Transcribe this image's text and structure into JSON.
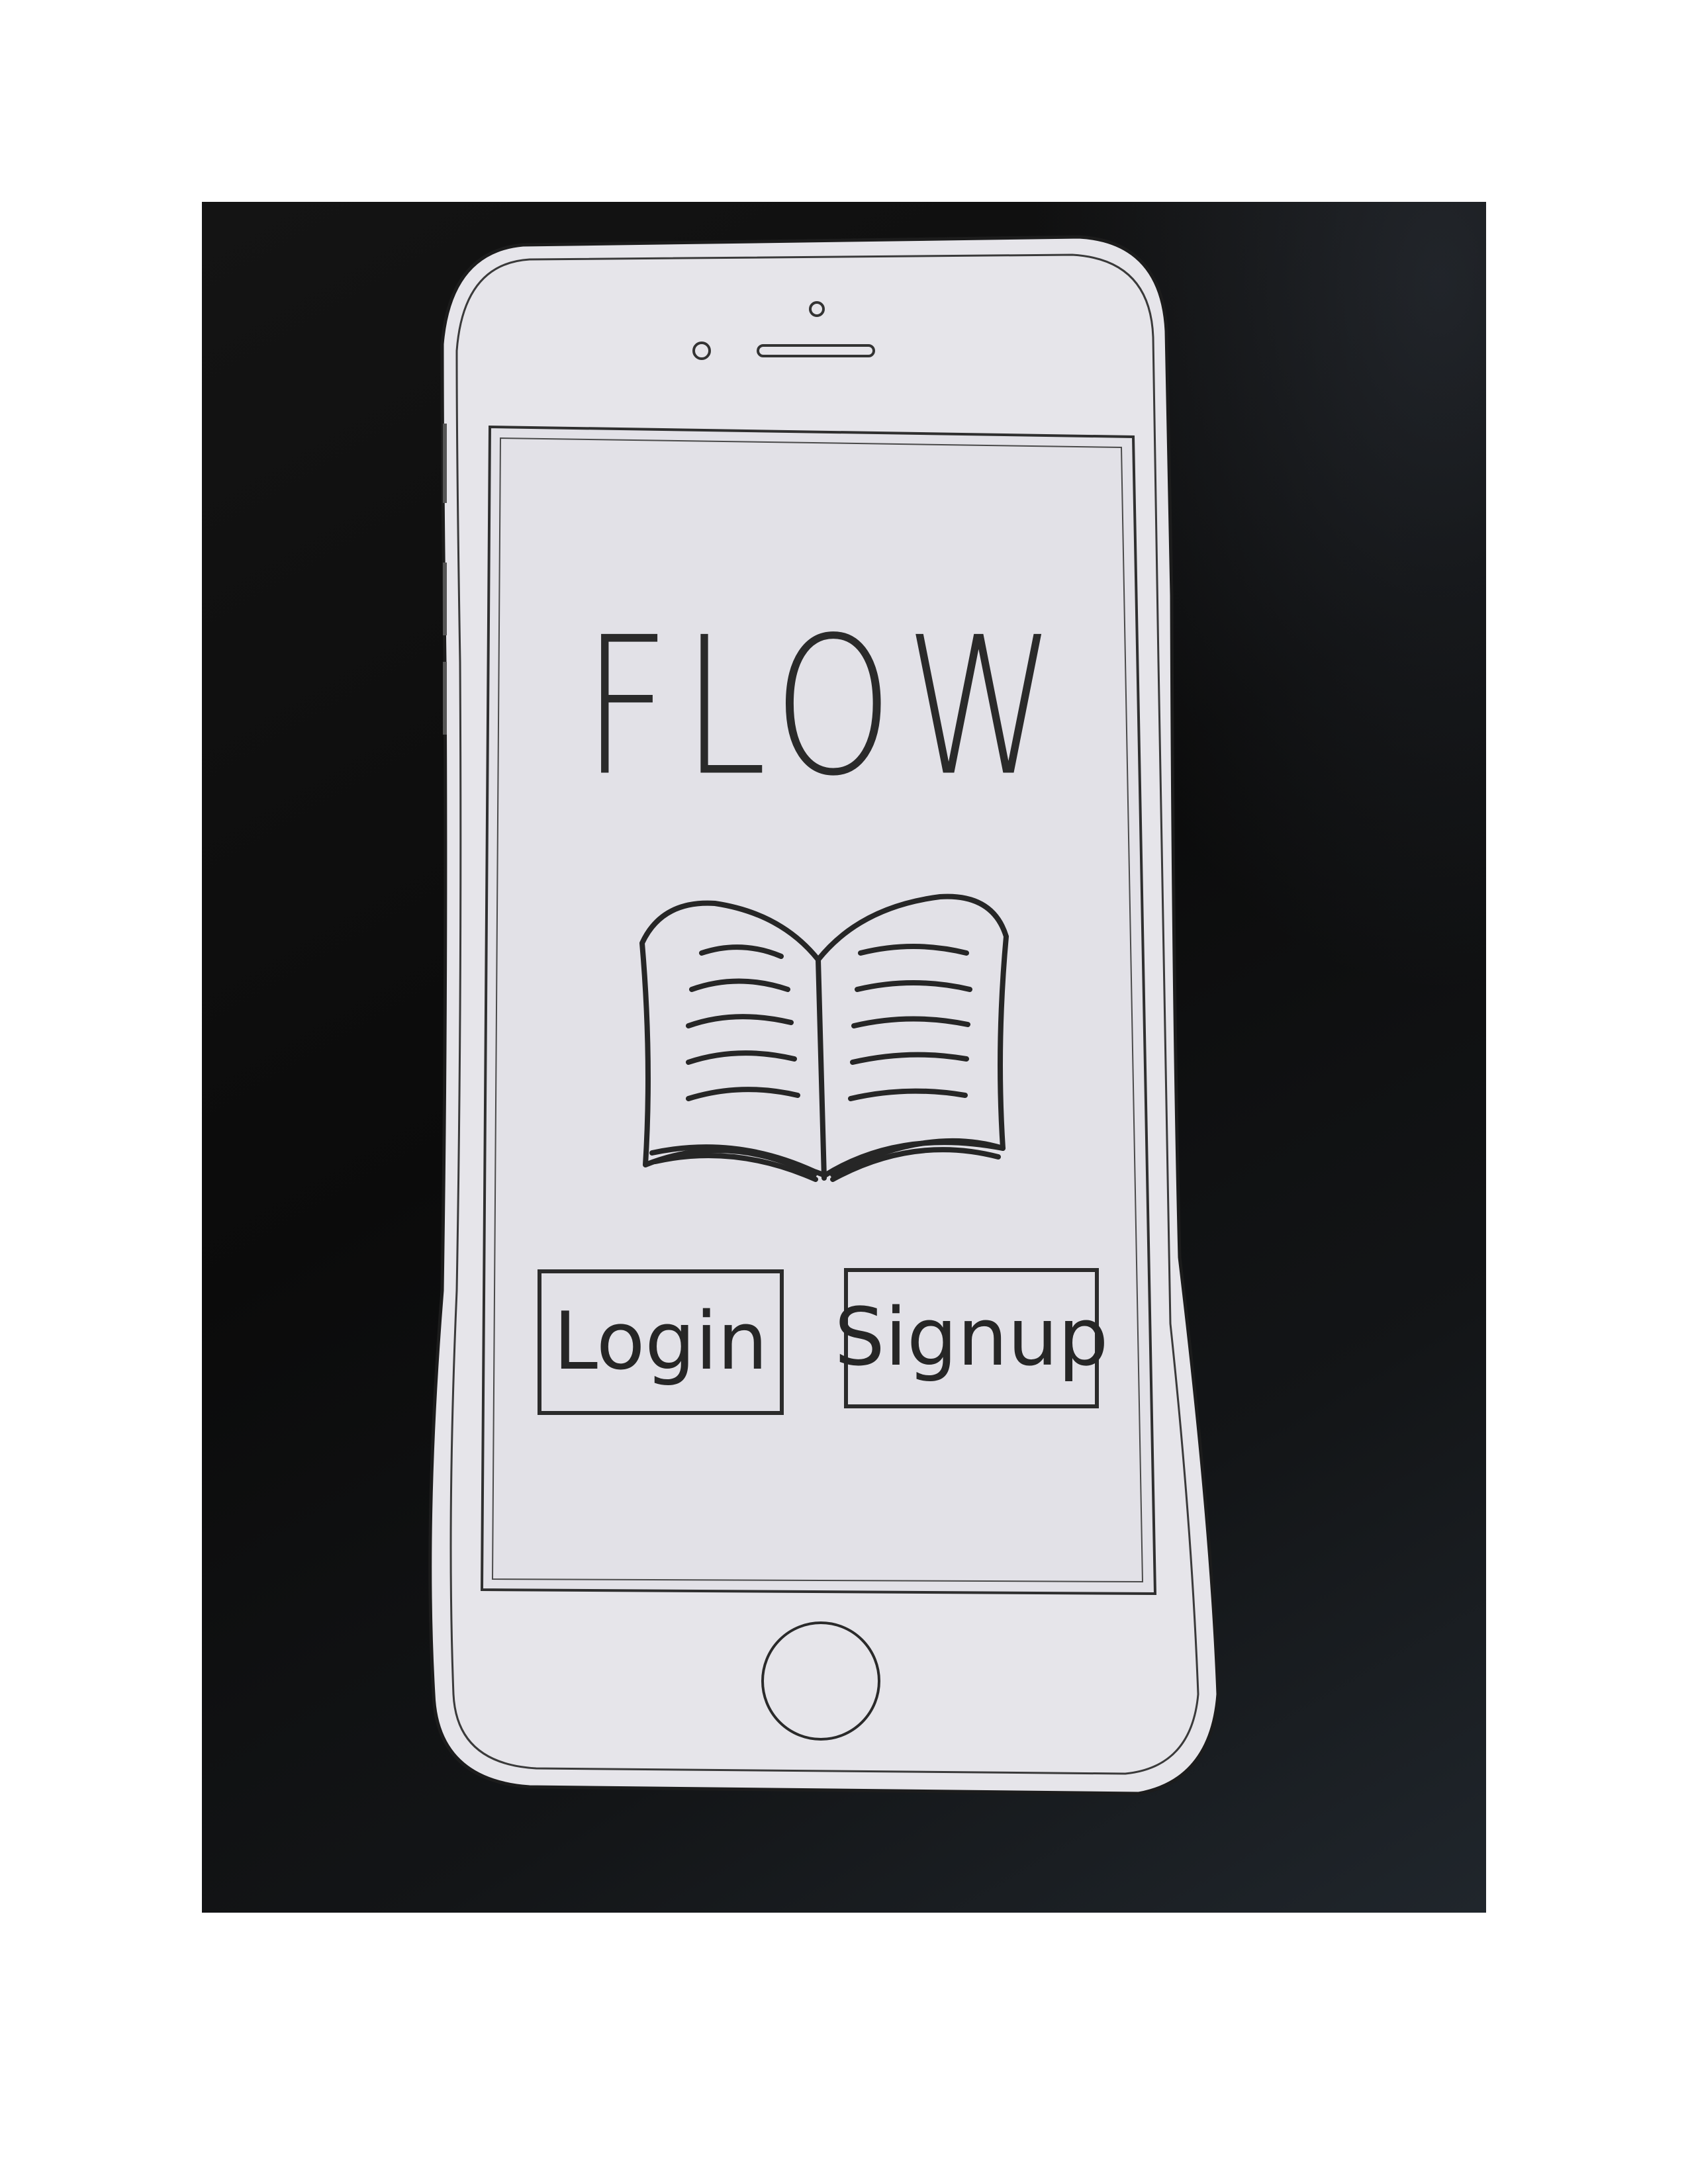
{
  "app": {
    "title": "FLOW"
  },
  "auth": {
    "login_label": "Login",
    "signup_label": "Signup"
  },
  "colors": {
    "paper": "#e6e5ea",
    "ink": "#2a2a2a",
    "background": "#0d0d0d"
  },
  "icons": {
    "logo": "open-book-icon"
  }
}
